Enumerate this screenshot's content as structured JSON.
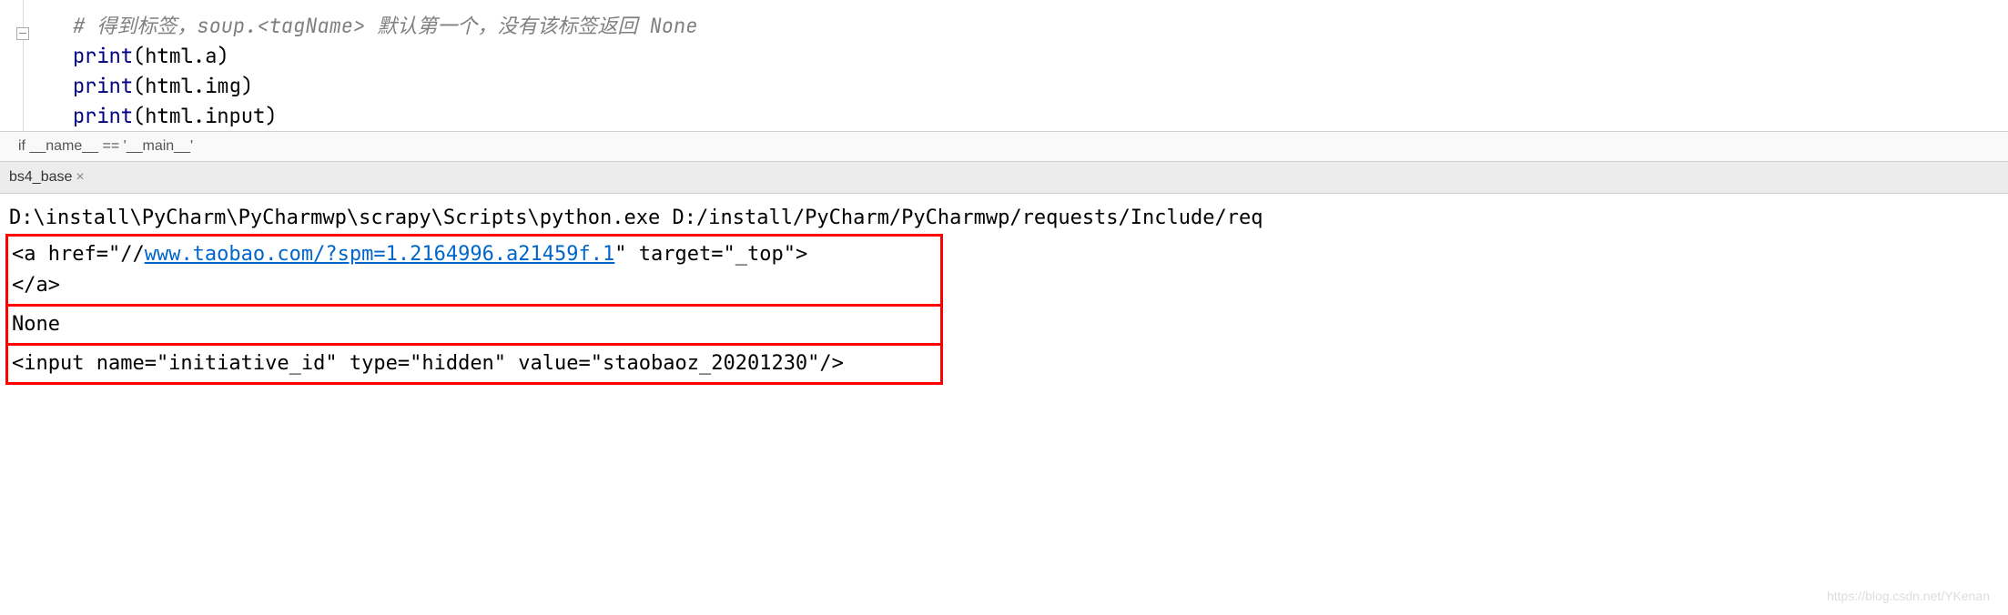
{
  "code": {
    "comment": "# 得到标签，soup.<tagName> 默认第一个，没有该标签返回 None",
    "line1_print": "print",
    "line1_arg": "html.a",
    "line2_print": "print",
    "line2_arg": "html.img",
    "line3_print": "print",
    "line3_arg": "html.input"
  },
  "breadcrumb": "if __name__ == '__main__'",
  "tab": {
    "name": "bs4_base",
    "close": "×"
  },
  "console": {
    "exec_path": "D:\\install\\PyCharm\\PyCharmwp\\scrapy\\Scripts\\python.exe D:/install/PyCharm/PyCharmwp/requests/Include/req",
    "output1_prefix": "<a href=\"//",
    "output1_link": "www.taobao.com/?spm=1.2164996.a21459f.1",
    "output1_suffix": "\" target=\"_top\">",
    "output1_close": "</a>",
    "output2": "None",
    "output3": "<input name=\"initiative_id\" type=\"hidden\" value=\"staobaoz_20201230\"/>"
  },
  "watermark": "https://blog.csdn.net/YKenan"
}
